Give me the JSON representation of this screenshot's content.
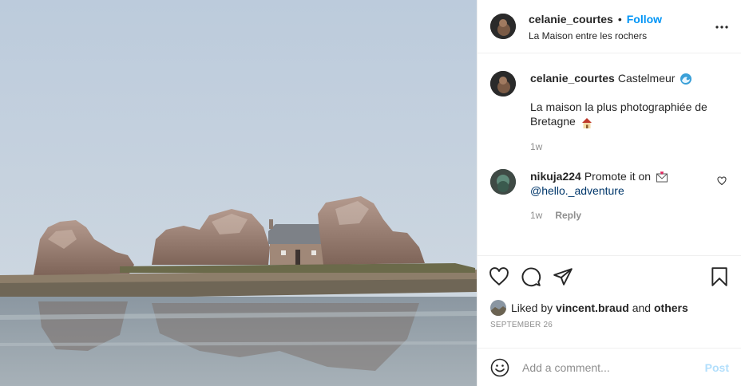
{
  "header": {
    "username": "celanie_courtes",
    "separator": "•",
    "follow_label": "Follow",
    "location": "La Maison entre les rochers"
  },
  "caption": {
    "username": "celanie_courtes",
    "line1": "Castelmeur",
    "line2": "La maison la plus photographiée de Bretagne",
    "time": "1w"
  },
  "comment": {
    "username": "nikuja224",
    "text": "Promote it on",
    "mention": "@hello._adventure",
    "time": "1w",
    "reply_label": "Reply"
  },
  "likes": {
    "prefix": "Liked by",
    "user": "vincent.braud",
    "and": "and",
    "others": "others"
  },
  "date": "SEPTEMBER 26",
  "add_comment": {
    "placeholder": "Add a comment...",
    "post_label": "Post"
  },
  "colors": {
    "link_blue": "#0095f6",
    "post_disabled": "#b2dffc",
    "muted": "#8e8e8e"
  },
  "icons": [
    "more-options-icon",
    "heart-icon",
    "comment-icon",
    "share-icon",
    "bookmark-icon",
    "smile-icon",
    "wave-emoji",
    "house-emoji",
    "envelope-emoji"
  ]
}
